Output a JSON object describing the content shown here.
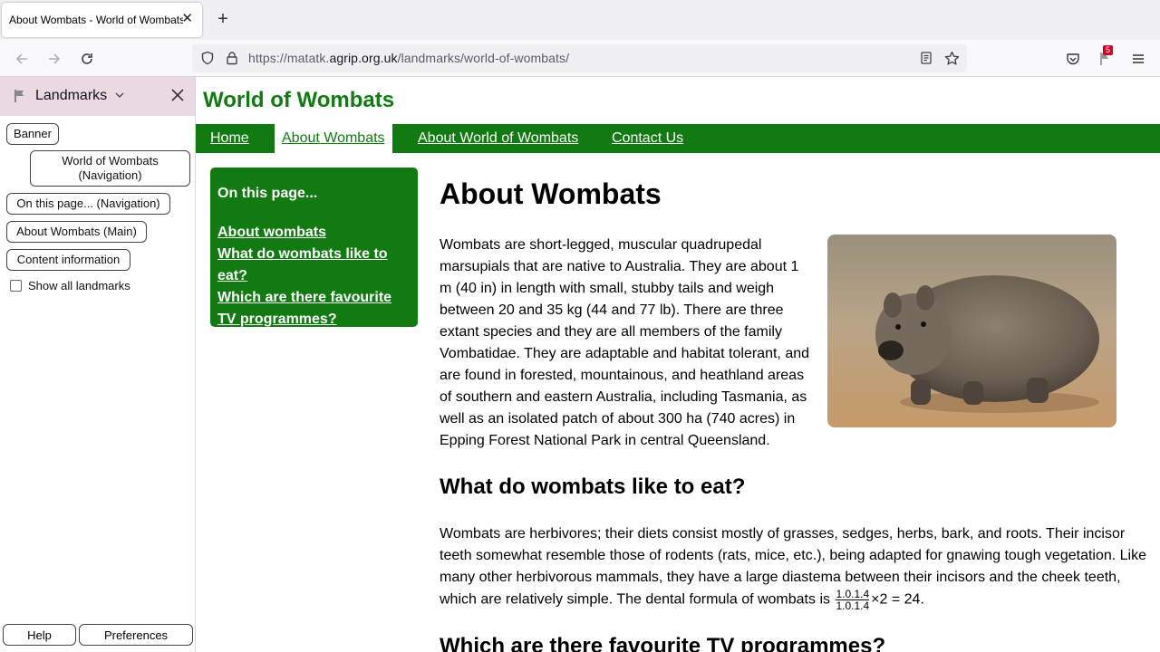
{
  "browser": {
    "tab_title": "About Wombats - World of Wombats",
    "url_prefix": "https://matatk.",
    "url_domain": "agrip.org.uk",
    "url_path": "/landmarks/world-of-wombats/",
    "extension_badge": "5"
  },
  "sidebar": {
    "title": "Landmarks",
    "landmarks": [
      "Banner",
      "World of Wombats (Navigation)",
      "On this page... (Navigation)",
      "About Wombats (Main)",
      "Content information"
    ],
    "show_all_label": "Show all landmarks",
    "help_label": "Help",
    "preferences_label": "Preferences"
  },
  "site": {
    "title": "World of Wombats",
    "nav": [
      "Home",
      "About Wombats",
      "About World of Wombats",
      "Contact Us"
    ],
    "current_nav": "About Wombats"
  },
  "on_this_page": {
    "heading": "On this page...",
    "links": [
      "About wombats",
      "What do wombats like to eat?",
      "Which are there favourite TV programmes?"
    ]
  },
  "main": {
    "heading": "About Wombats",
    "intro": "Wombats are short-legged, muscular quadrupedal marsupials that are native to Australia. They are about 1 m (40 in) in length with small, stubby tails and weigh between 20 and 35 kg (44 and 77 lb). There are three extant species and they are all members of the family Vombatidae. They are adaptable and habitat tolerant, and are found in forested, mountainous, and heathland areas of southern and eastern Australia, including Tasmania, as well as an isolated patch of about 300 ha (740 acres) in Epping Forest National Park in central Queensland.",
    "eat_heading": "What do wombats like to eat?",
    "eat_text": "Wombats are herbivores; their diets consist mostly of grasses, sedges, herbs, bark, and roots. Their incisor teeth somewhat resemble those of rodents (rats, mice, etc.), being adapted for gnawing tough vegetation. Like many other herbivorous mammals, they have a large diastema between their incisors and the cheek teeth, which are relatively simple. The dental formula of wombats is",
    "formula_num": "1.0.1.4",
    "formula_den": "1.0.1.4",
    "formula_tail": "×2 = 24.",
    "tv_heading": "Which are there favourite TV programmes?"
  }
}
